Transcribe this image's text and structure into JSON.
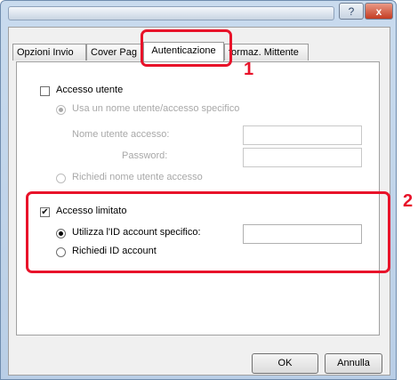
{
  "window": {
    "help_label": "?",
    "close_label": "x"
  },
  "tabs": [
    {
      "label": "Opzioni Invio"
    },
    {
      "label": "Cover Pag"
    },
    {
      "label": "Autenticazione"
    },
    {
      "label": "formaz. Mittente"
    }
  ],
  "user_access": {
    "checkbox_label": "Accesso utente",
    "checked": false,
    "radio_specific_label": "Usa un nome utente/accesso specifico",
    "username_label": "Nome utente accesso:",
    "username_value": "",
    "password_label": "Password:",
    "password_value": "",
    "radio_ask_label": "Richiedi nome utente accesso"
  },
  "limited_access": {
    "checkbox_label": "Accesso limitato",
    "checked": true,
    "radio_specific_label": "Utilizza l'ID account specifico:",
    "account_id_value": "",
    "radio_ask_label": "Richiedi ID account"
  },
  "buttons": {
    "ok_label": "OK",
    "cancel_label": "Annulla"
  },
  "annotations": {
    "step1": "1",
    "step2": "2",
    "color": "#e8132a"
  }
}
